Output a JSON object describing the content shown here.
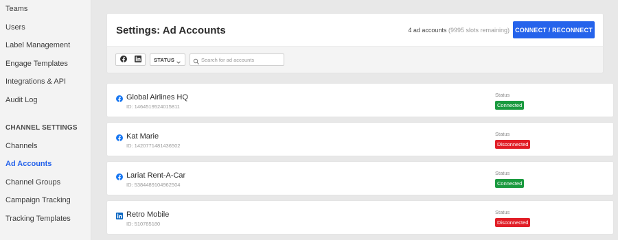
{
  "sidebar": {
    "items": [
      {
        "label": "Teams"
      },
      {
        "label": "Users"
      },
      {
        "label": "Label Management"
      },
      {
        "label": "Engage Templates"
      },
      {
        "label": "Integrations & API"
      },
      {
        "label": "Audit Log"
      }
    ],
    "section_heading": "CHANNEL SETTINGS",
    "channel_items": [
      {
        "label": "Channels"
      },
      {
        "label": "Ad Accounts",
        "active": true
      },
      {
        "label": "Channel Groups"
      },
      {
        "label": "Campaign Tracking"
      },
      {
        "label": "Tracking Templates"
      }
    ]
  },
  "header": {
    "title": "Settings: Ad Accounts",
    "count_text": "4 ad accounts",
    "slots_text": "(9995 slots remaining)",
    "connect_label": "CONNECT / RECONNECT"
  },
  "filters": {
    "network_icons": [
      "facebook-icon",
      "linkedin-icon"
    ],
    "status_label": "STATUS",
    "search_placeholder": "Search for ad accounts",
    "search_value": ""
  },
  "accounts": [
    {
      "network": "facebook",
      "name": "Global Airlines HQ",
      "id": "ID: 1464519524015811",
      "status_label": "Status",
      "status": "Connected"
    },
    {
      "network": "facebook",
      "name": "Kat Marie",
      "id": "ID: 1420771481436502",
      "status_label": "Status",
      "status": "Disconnected"
    },
    {
      "network": "facebook",
      "name": "Lariat Rent-A-Car",
      "id": "ID: 5384489104962504",
      "status_label": "Status",
      "status": "Connected"
    },
    {
      "network": "linkedin",
      "name": "Retro Mobile",
      "id": "ID: 510785180",
      "status_label": "Status",
      "status": "Disconnected"
    }
  ],
  "colors": {
    "accent": "#2563eb",
    "connected": "#1a9a3f",
    "disconnected": "#e11d26",
    "facebook": "#1877f2",
    "linkedin": "#0a66c2"
  }
}
